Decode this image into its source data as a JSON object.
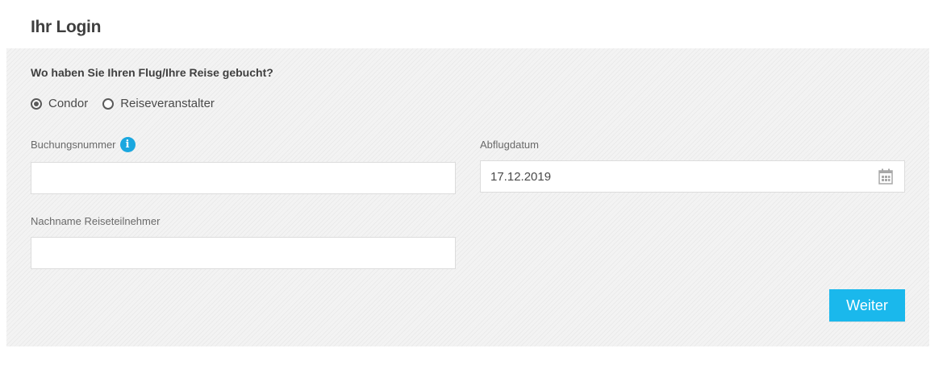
{
  "page": {
    "title": "Ihr Login"
  },
  "form": {
    "question": "Wo haben Sie Ihren Flug/Ihre Reise gebucht?",
    "options": [
      {
        "label": "Condor",
        "checked": true
      },
      {
        "label": "Reiseveranstalter",
        "checked": false
      }
    ],
    "booking_number": {
      "label": "Buchungsnummer",
      "value": "",
      "info_icon": "info-icon"
    },
    "departure_date": {
      "label": "Abflugdatum",
      "value": "17.12.2019",
      "icon": "calendar-icon"
    },
    "last_name": {
      "label": "Nachname Reiseteilnehmer",
      "value": ""
    },
    "submit_label": "Weiter"
  },
  "colors": {
    "accent": "#1ab8ec",
    "info": "#1aa7df",
    "panel_bg": "#f3f3f3"
  }
}
